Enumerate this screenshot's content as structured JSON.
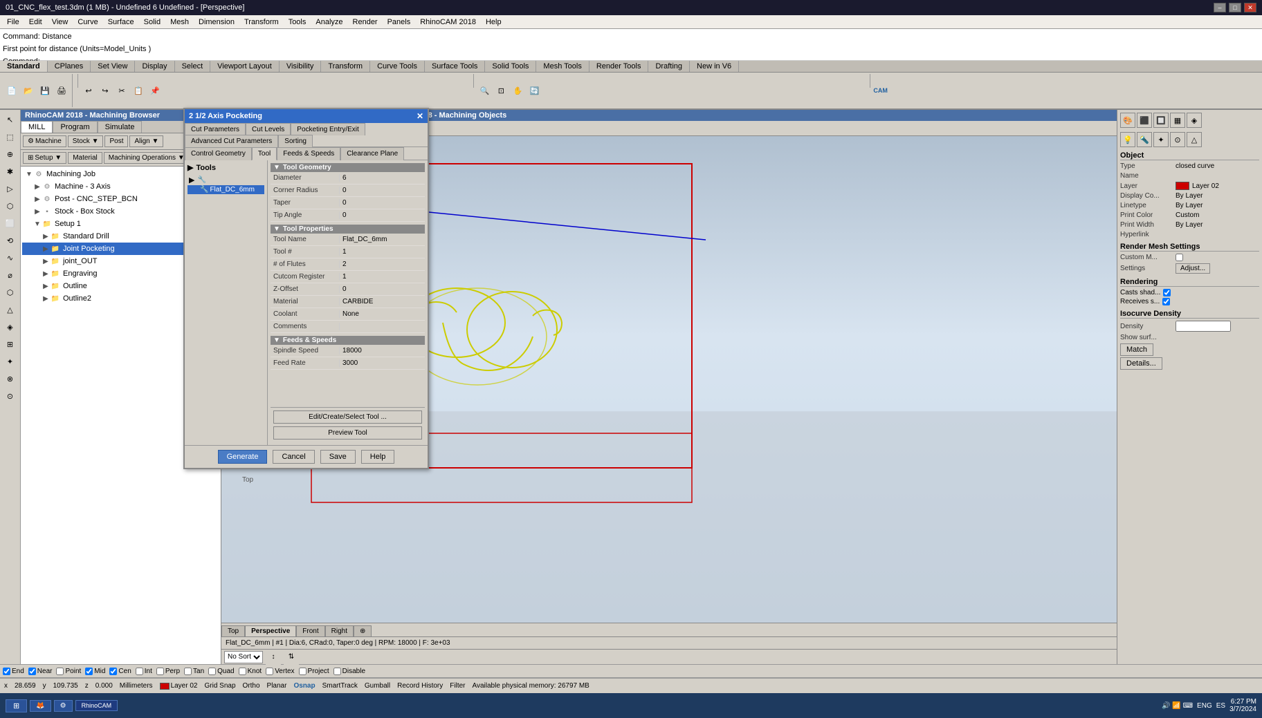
{
  "window": {
    "title": "01_CNC_flex_test.3dm (1 MB) - Undefined 6 Undefined - [Perspective]",
    "controls": [
      "–",
      "□",
      "✕"
    ]
  },
  "menu": {
    "items": [
      "File",
      "Edit",
      "View",
      "Curve",
      "Surface",
      "Solid",
      "Mesh",
      "Dimension",
      "Transform",
      "Tools",
      "Analyze",
      "Render",
      "Panels",
      "RhinoCAM 2018",
      "Help"
    ]
  },
  "command": {
    "line1": "Command: Distance",
    "line2": "First point for distance (Units=Model_Units )",
    "line3": "Command:"
  },
  "ribbon": {
    "tabs": [
      "Standard",
      "CPlanes",
      "Set View",
      "Display",
      "Select",
      "Viewport Layout",
      "Visibility",
      "Transform",
      "Curve Tools",
      "Surface Tools",
      "Solid Tools",
      "Mesh Tools",
      "Render Tools",
      "Drafting",
      "New in V6"
    ],
    "active_tab": "Standard"
  },
  "machining_browser": {
    "title": "RhinoCAM 2018 - Machining Browser",
    "tabs": [
      "MILL",
      "Program",
      "Simulate"
    ],
    "active_tab": "MILL",
    "controls": {
      "machine_btn": "Machine",
      "stock_btn": "Stock ▼",
      "post_btn": "Post",
      "align_btn": "Align ▼",
      "setup_btn": "Setup ▼",
      "material_btn": "Material",
      "machining_operations": "Machining Operations ▼"
    },
    "tree": [
      {
        "level": 0,
        "expanded": true,
        "icon": "gear",
        "label": "Machining Job"
      },
      {
        "level": 1,
        "expanded": false,
        "icon": "gear",
        "label": "Machine - 3 Axis"
      },
      {
        "level": 1,
        "expanded": false,
        "icon": "gear",
        "label": "Post - CNC_STEP_BCN"
      },
      {
        "level": 1,
        "expanded": false,
        "icon": "box",
        "label": "Stock - Box Stock"
      },
      {
        "level": 1,
        "expanded": true,
        "icon": "folder",
        "label": "Setup 1"
      },
      {
        "level": 2,
        "expanded": false,
        "icon": "folder",
        "label": "Standard Drill"
      },
      {
        "level": 2,
        "expanded": false,
        "icon": "folder",
        "selected": true,
        "label": "Joint Pocketing"
      },
      {
        "level": 2,
        "expanded": false,
        "icon": "folder",
        "label": "joint_OUT"
      },
      {
        "level": 2,
        "expanded": false,
        "icon": "folder",
        "label": "Engraving"
      },
      {
        "level": 2,
        "expanded": false,
        "icon": "folder",
        "label": "Outline"
      },
      {
        "level": 2,
        "expanded": false,
        "icon": "folder",
        "label": "Outline2"
      }
    ]
  },
  "dialog": {
    "title": "2 1/2 Axis Pocketing",
    "tabs": [
      "Cut Parameters",
      "Cut Levels",
      "Pocketing Entry/Exit",
      "Advanced Cut Parameters",
      "Sorting",
      "Control Geometry",
      "Tool",
      "Feeds & Speeds",
      "Clearance Plane"
    ],
    "active_tab": "Tool",
    "tools_panel": {
      "header": "Tools",
      "expand": "▶",
      "nodes": [
        {
          "level": 0,
          "label": "▶",
          "type": "expand"
        },
        {
          "level": 1,
          "selected": true,
          "label": "Flat_DC_6mm",
          "icon": "tool"
        }
      ]
    },
    "tool_geometry": {
      "section": "Tool Geometry",
      "fields": [
        {
          "key": "Diameter",
          "value": "6"
        },
        {
          "key": "Corner Radius",
          "value": "0"
        },
        {
          "key": "Taper",
          "value": "0"
        },
        {
          "key": "Tip Angle",
          "value": "0"
        }
      ]
    },
    "tool_properties": {
      "section": "Tool Properties",
      "fields": [
        {
          "key": "Tool Name",
          "value": "Flat_DC_6mm"
        },
        {
          "key": "Tool #",
          "value": "1"
        },
        {
          "key": "# of Flutes",
          "value": "2"
        },
        {
          "key": "Cutcom Register",
          "value": "1"
        },
        {
          "key": "Z-Offset",
          "value": "0"
        },
        {
          "key": "Material",
          "value": "CARBIDE"
        },
        {
          "key": "Coolant",
          "value": "None"
        },
        {
          "key": "Comments",
          "value": ""
        }
      ]
    },
    "feeds_speeds": {
      "section": "Feeds & Speeds",
      "fields": [
        {
          "key": "Spindle Speed",
          "value": "18000"
        },
        {
          "key": "Feed Rate",
          "value": "3000"
        }
      ]
    },
    "actions": {
      "edit_btn": "Edit/Create/Select Tool ...",
      "preview_btn": "Preview Tool"
    },
    "footer": {
      "generate": "Generate",
      "cancel": "Cancel",
      "save": "Save",
      "help": "Help"
    }
  },
  "machining_objects": {
    "title": "RhinoCAM 2018 - Machining Objects"
  },
  "viewport": {
    "label": "Perspective",
    "tabs": [
      "Top",
      "Perspective",
      "Front",
      "Right",
      "⊕"
    ]
  },
  "right_panel": {
    "title": "Object",
    "properties": [
      {
        "key": "Type",
        "value": "closed curve"
      },
      {
        "key": "Name",
        "value": ""
      },
      {
        "key": "Layer",
        "value": "Layer 02"
      },
      {
        "key": "Display Co...",
        "value": "By Layer"
      },
      {
        "key": "Linetype",
        "value": "By Layer"
      },
      {
        "key": "Print Color",
        "value": "Custom"
      },
      {
        "key": "Print Width",
        "value": "By Layer"
      },
      {
        "key": "Hyperlink",
        "value": ""
      }
    ],
    "render_mesh": {
      "title": "Render Mesh Settings",
      "custom_m_label": "Custom M...",
      "settings_label": "Settings",
      "adjust_btn": "Adjust..."
    },
    "rendering": {
      "title": "Rendering",
      "casts_shadow": "Casts shad...",
      "receives": "Receives s..."
    },
    "isocurve": {
      "title": "Isocurve Density",
      "density_label": "Density",
      "show_surf": "Show surf..."
    },
    "match_btn": "Match",
    "details_btn": "Details..."
  },
  "status": {
    "coords": {
      "x": "28.659",
      "y": "109.735",
      "z": "0.000"
    },
    "units": "Millimeters",
    "layer": "Layer 02",
    "grid_snap": "Grid Snap",
    "ortho": "Ortho",
    "planar": "Planar",
    "osnap": "Osnap",
    "smart_track": "SmartTrack",
    "gumball": "Gumball",
    "record_history": "Record History",
    "filter": "Filter",
    "memory": "Available physical memory: 26797 MB"
  },
  "snap_bar": {
    "items": [
      "End",
      "Near",
      "Point",
      "Mid",
      "Cen",
      "Int",
      "Perp",
      "Tan",
      "Quad",
      "Knot",
      "Vertex",
      "Project",
      "Disable"
    ]
  },
  "taskbar": {
    "start_icon": "⊞",
    "apps": [
      "🦊",
      "⚙"
    ],
    "tray": {
      "lang": "ENG",
      "locale": "ES",
      "time": "6:27 PM",
      "date": "3/7/2024"
    }
  },
  "no_sort": "No Sort",
  "icons": {
    "search": "🔍",
    "gear": "⚙",
    "folder": "📁",
    "tool": "🔧",
    "plus": "+",
    "minus": "−",
    "expand": "▶",
    "collapse": "▼",
    "close": "✕",
    "check": "✓"
  }
}
